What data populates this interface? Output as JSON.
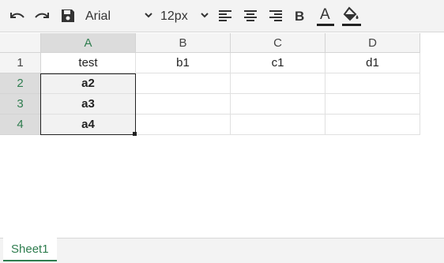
{
  "toolbar": {
    "undo_icon": "undo-icon",
    "redo_icon": "redo-icon",
    "save_icon": "save-icon",
    "font_family": "Arial",
    "font_size": "12px",
    "bold_label": "B",
    "text_color_label": "A",
    "accent_color": "#2f7d4f"
  },
  "columns": [
    "A",
    "B",
    "C",
    "D"
  ],
  "rows": [
    {
      "num": "1",
      "cells": [
        "test",
        "b1",
        "c1",
        "d1"
      ]
    },
    {
      "num": "2",
      "cells": [
        "a2",
        "",
        "",
        ""
      ]
    },
    {
      "num": "3",
      "cells": [
        "a3",
        "",
        "",
        ""
      ]
    },
    {
      "num": "4",
      "cells": [
        "a4",
        "",
        "",
        ""
      ]
    }
  ],
  "sheet_tab": "Sheet1"
}
